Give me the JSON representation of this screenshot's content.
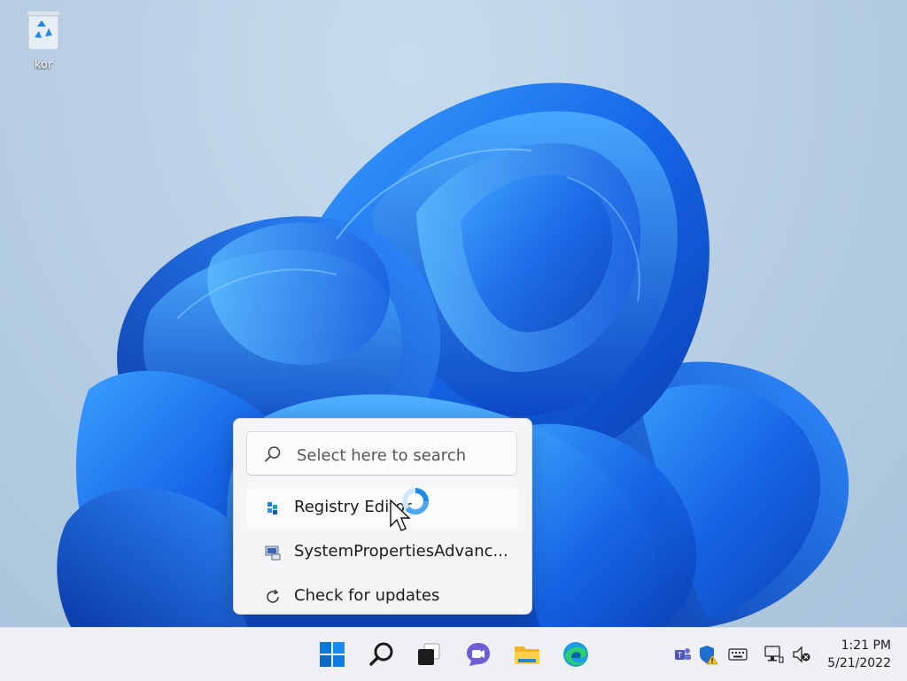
{
  "desktop": {
    "icons": [
      {
        "label": "kor",
        "icon": "recycle-bin-icon"
      }
    ]
  },
  "search": {
    "placeholder": "Select here to search",
    "results": [
      {
        "label": "Registry Editor",
        "icon": "registry-editor-icon"
      },
      {
        "label": "SystemPropertiesAdvanc...",
        "icon": "system-properties-icon"
      },
      {
        "label": "Check for updates",
        "icon": "refresh-icon"
      }
    ]
  },
  "taskbar": {
    "apps": [
      {
        "name": "Start",
        "icon": "windows-start-icon"
      },
      {
        "name": "Search",
        "icon": "search-icon"
      },
      {
        "name": "Task View",
        "icon": "task-view-icon"
      },
      {
        "name": "Chat",
        "icon": "chat-icon"
      },
      {
        "name": "File Explorer",
        "icon": "folder-icon"
      },
      {
        "name": "Microsoft Edge",
        "icon": "edge-icon"
      }
    ],
    "tray": [
      {
        "name": "Teams",
        "icon": "teams-icon"
      },
      {
        "name": "Windows Security",
        "icon": "security-warning-icon"
      },
      {
        "name": "Keyboard",
        "icon": "keyboard-icon"
      },
      {
        "name": "Network",
        "icon": "network-icon"
      },
      {
        "name": "Volume",
        "icon": "volume-muted-icon"
      }
    ],
    "clock": {
      "time": "1:21 PM",
      "date": "5/21/2022"
    }
  },
  "colors": {
    "accent": "#0067c0",
    "wallpaper_blue": "#1f6fe0",
    "taskbar_bg": "#eef0f3"
  }
}
